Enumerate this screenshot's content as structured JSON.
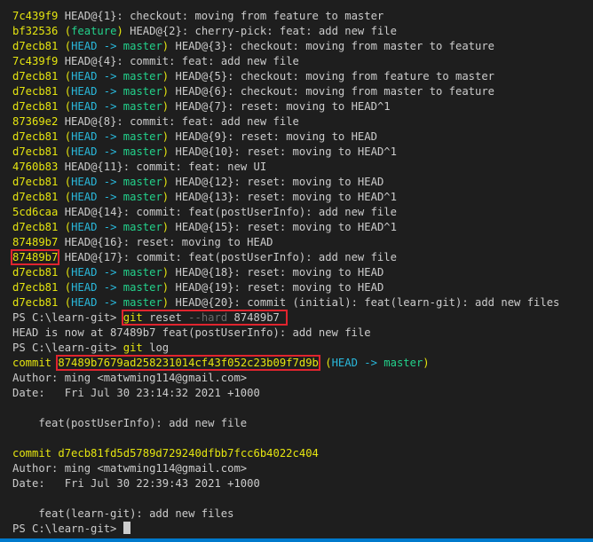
{
  "reflog": [
    {
      "hash": "7c439f9",
      "ref": "",
      "rest": "HEAD@{1}: checkout: moving from feature to master"
    },
    {
      "hash": "bf32536",
      "ref": "feature",
      "rest": "HEAD@{2}: cherry-pick: feat: add new file"
    },
    {
      "hash": "d7ecb81",
      "ref": "HEAD -> master",
      "rest": "HEAD@{3}: checkout: moving from master to feature"
    },
    {
      "hash": "7c439f9",
      "ref": "",
      "rest": "HEAD@{4}: commit: feat: add new file"
    },
    {
      "hash": "d7ecb81",
      "ref": "HEAD -> master",
      "rest": "HEAD@{5}: checkout: moving from feature to master"
    },
    {
      "hash": "d7ecb81",
      "ref": "HEAD -> master",
      "rest": "HEAD@{6}: checkout: moving from master to feature"
    },
    {
      "hash": "d7ecb81",
      "ref": "HEAD -> master",
      "rest": "HEAD@{7}: reset: moving to HEAD^1"
    },
    {
      "hash": "87369e2",
      "ref": "",
      "rest": "HEAD@{8}: commit: feat: add new file"
    },
    {
      "hash": "d7ecb81",
      "ref": "HEAD -> master",
      "rest": "HEAD@{9}: reset: moving to HEAD"
    },
    {
      "hash": "d7ecb81",
      "ref": "HEAD -> master",
      "rest": "HEAD@{10}: reset: moving to HEAD^1"
    },
    {
      "hash": "4760b83",
      "ref": "",
      "rest": "HEAD@{11}: commit: feat: new UI"
    },
    {
      "hash": "d7ecb81",
      "ref": "HEAD -> master",
      "rest": "HEAD@{12}: reset: moving to HEAD"
    },
    {
      "hash": "d7ecb81",
      "ref": "HEAD -> master",
      "rest": "HEAD@{13}: reset: moving to HEAD^1"
    },
    {
      "hash": "5cd6caa",
      "ref": "",
      "rest": "HEAD@{14}: commit: feat(postUserInfo): add new file"
    },
    {
      "hash": "d7ecb81",
      "ref": "HEAD -> master",
      "rest": "HEAD@{15}: reset: moving to HEAD^1"
    },
    {
      "hash": "87489b7",
      "ref": "",
      "rest": "HEAD@{16}: reset: moving to HEAD"
    },
    {
      "hash": "87489b7",
      "ref": "",
      "rest": "HEAD@{17}: commit: feat(postUserInfo): add new file",
      "highlight": true
    },
    {
      "hash": "d7ecb81",
      "ref": "HEAD -> master",
      "rest": "HEAD@{18}: reset: moving to HEAD"
    },
    {
      "hash": "d7ecb81",
      "ref": "HEAD -> master",
      "rest": "HEAD@{19}: reset: moving to HEAD"
    },
    {
      "hash": "d7ecb81",
      "ref": "HEAD -> master",
      "rest": "HEAD@{20}: commit (initial): feat(learn-git): add new files"
    }
  ],
  "prompt": "PS C:\\learn-git> ",
  "cmd_reset": {
    "git": "git",
    "sub": " reset ",
    "flag": "--hard",
    "arg": " 87489b7"
  },
  "reset_output": "HEAD is now at 87489b7 feat(postUserInfo): add new file",
  "cmd_log": {
    "git": "git",
    "sub": " log"
  },
  "log": [
    {
      "commit_word": "commit ",
      "hash": "87489b7679ad258231014cf43f052c23b09f7d9b",
      "ref_open": " (",
      "ref_head": "HEAD -> ",
      "ref_branch": "master",
      "ref_close": ")",
      "author": "Author: ming <matwming114@gmail.com>",
      "date": "Date:   Fri Jul 30 23:14:32 2021 +1000",
      "message": "    feat(postUserInfo): add new file"
    },
    {
      "commit_word": "commit ",
      "hash": "d7ecb81fd5d5789d729240dfbb7fcc6b4022c404",
      "author": "Author: ming <matwming114@gmail.com>",
      "date": "Date:   Fri Jul 30 22:39:43 2021 +1000",
      "message": "    feat(learn-git): add new files"
    }
  ],
  "colors": {
    "background": "#1e1e1e",
    "text": "#cccccc",
    "hash_yellow": "#e5e510",
    "head_cyan": "#29b8db",
    "branch_green": "#23d18b",
    "highlight_red": "#e0242e",
    "status_bar_blue": "#007acc"
  }
}
